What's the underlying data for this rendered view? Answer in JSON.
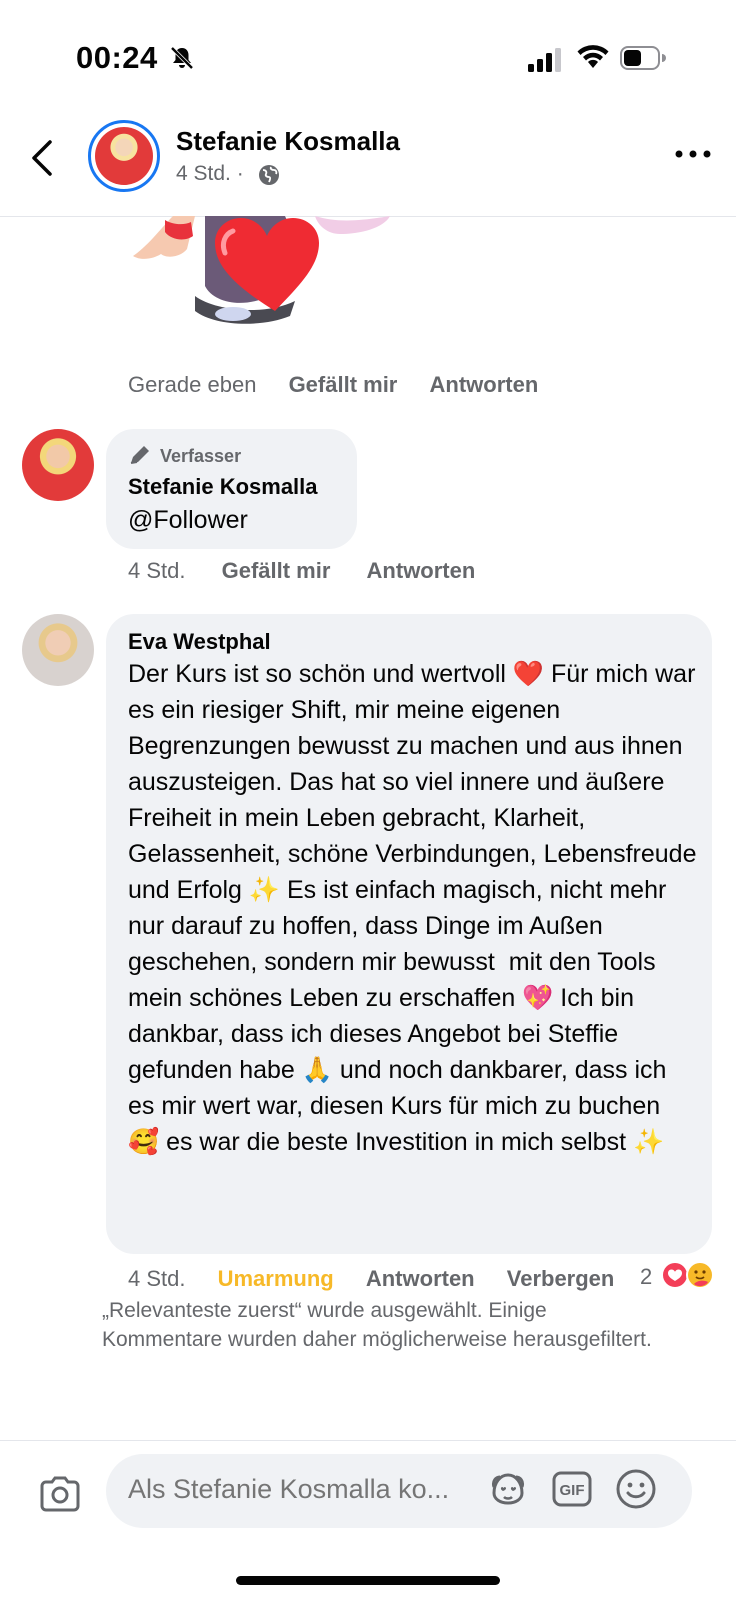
{
  "status": {
    "time": "00:24"
  },
  "header": {
    "name": "Stefanie Kosmalla",
    "meta": "4 Std. ·"
  },
  "sticker_actions": {
    "time": "Gerade eben",
    "like": "Gefällt mir",
    "reply": "Antworten"
  },
  "comment1": {
    "badge": "Verfasser",
    "author": "Stefanie Kosmalla",
    "text": "@Follower",
    "time": "4 Std.",
    "like": "Gefällt mir",
    "reply": "Antworten"
  },
  "comment2": {
    "author": "Eva Westphal",
    "text": "Der Kurs ist so schön und wertvoll ❤️ Für mich war es ein riesiger Shift, mir meine eigenen Begrenzungen bewusst zu machen und aus ihnen auszusteigen. Das hat so viel innere und äußere Freiheit in mein Leben gebracht, Klarheit, Gelassenheit, schöne Verbindungen, Lebensfreude und Erfolg ✨ Es ist einfach magisch, nicht mehr nur darauf zu hoffen, dass Dinge im Außen geschehen, sondern mir bewusst  mit den Tools mein schönes Leben zu erschaffen 💖 Ich bin dankbar, dass ich dieses Angebot bei Steffie gefunden habe 🙏 und noch dankbarer, dass ich es mir wert war, diesen Kurs für mich zu buchen 🥰 es war die beste Investition in mich selbst ✨",
    "time": "4 Std.",
    "react_label": "Umarmung",
    "reply": "Antworten",
    "hide": "Verbergen",
    "reaction_count": "2"
  },
  "note": "„Relevanteste zuerst“ wurde ausgewählt. Einige Kommentare wurden daher möglicherweise herausgefiltert.",
  "composer": {
    "placeholder": "Als Stefanie Kosmalla ko..."
  },
  "colors": {
    "accent": "#1877f2",
    "hug": "#f7b928",
    "bubble": "#f0f2f5",
    "muted": "#65676b"
  }
}
